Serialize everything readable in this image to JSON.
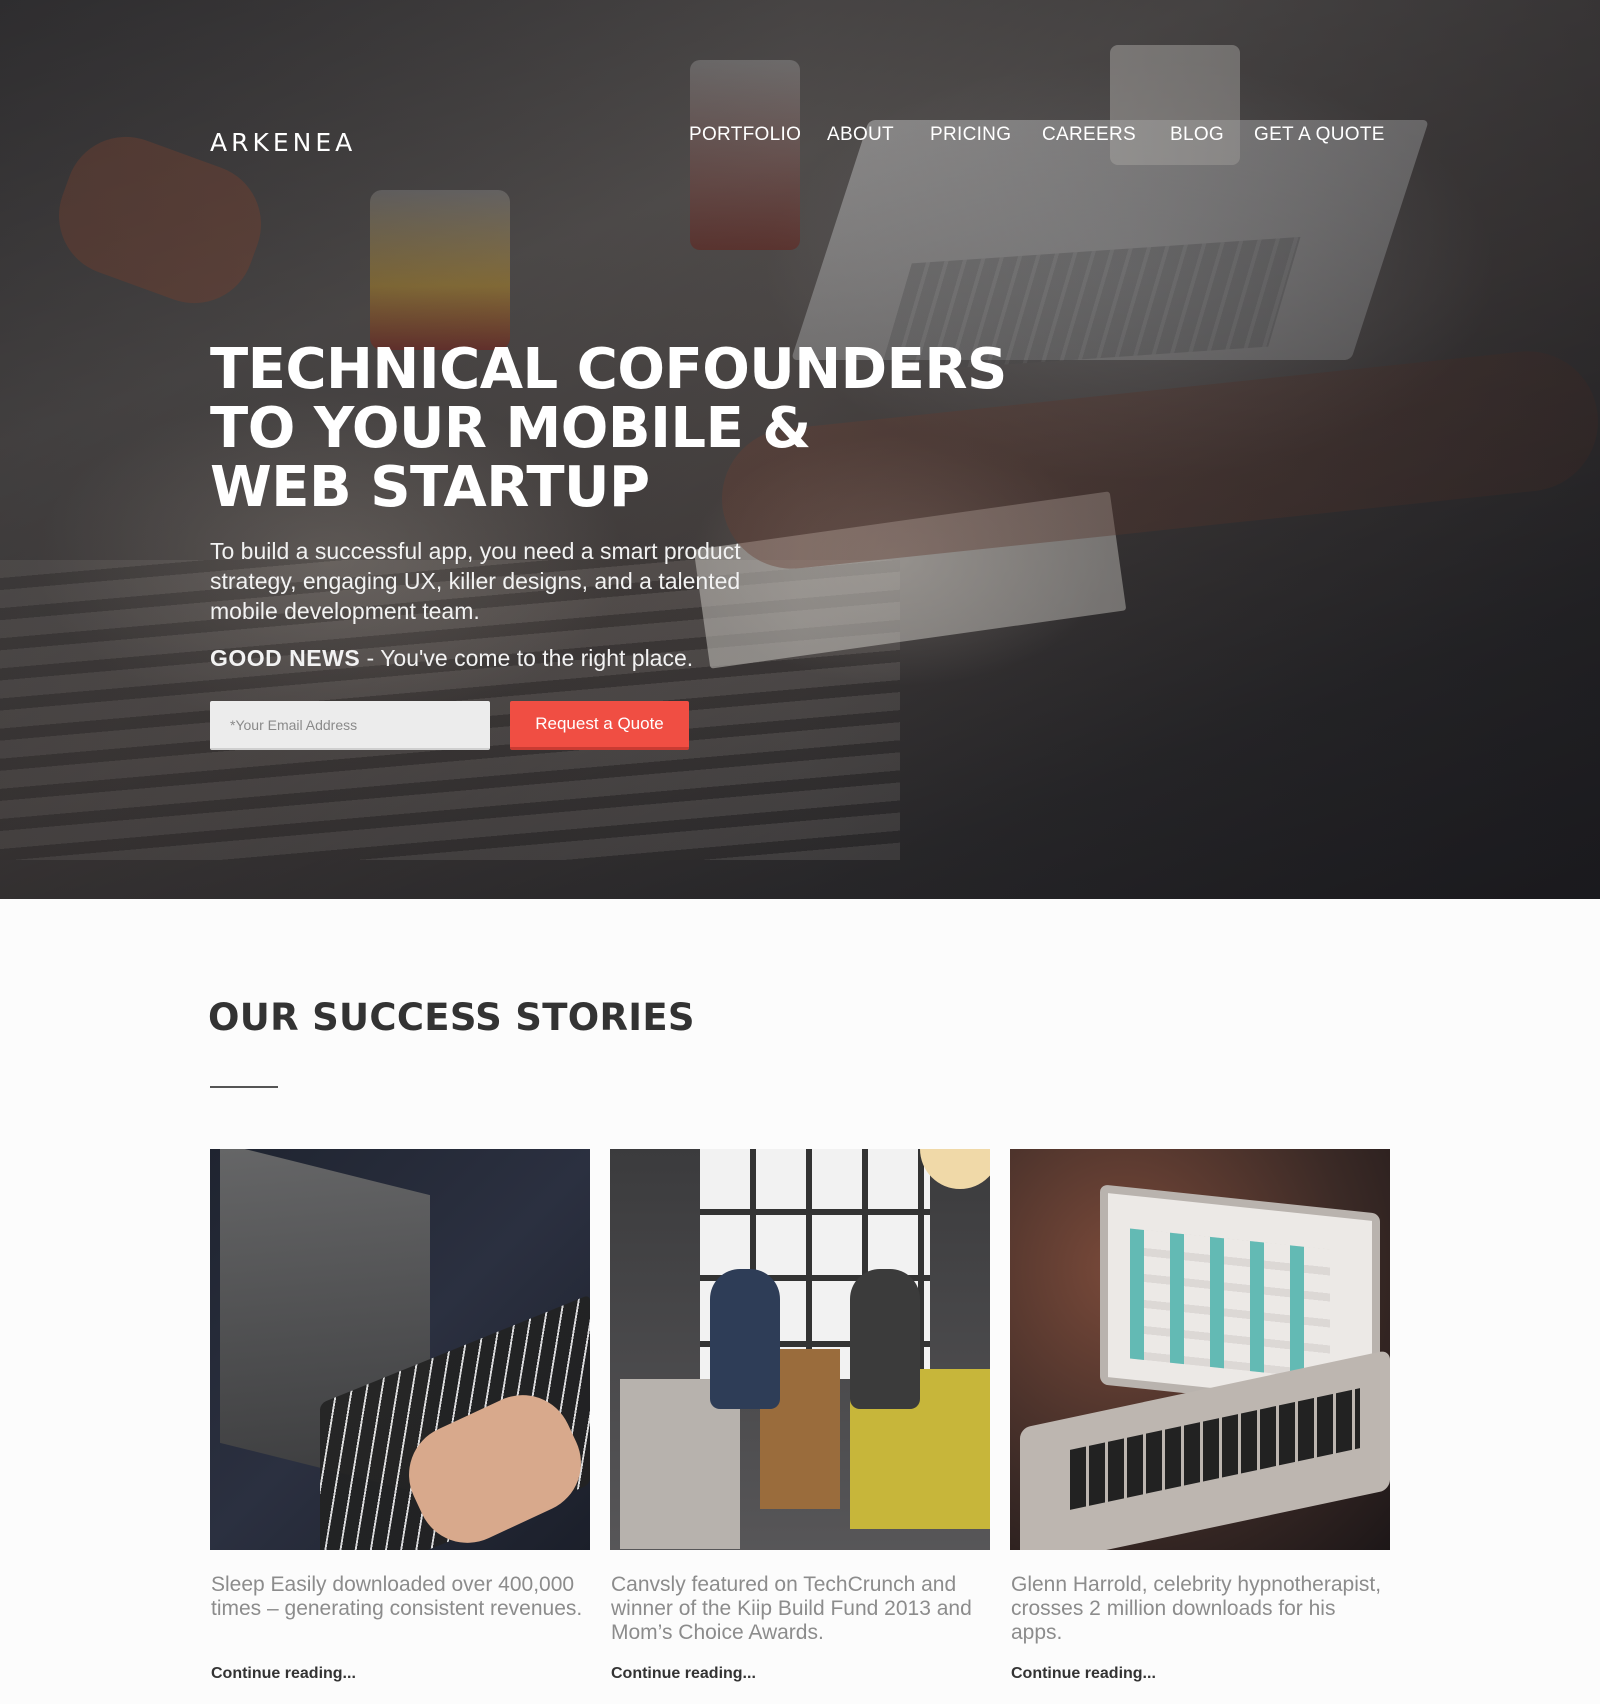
{
  "brand": {
    "logo_text": "ARKENEA",
    "accent_color": "#f04e43"
  },
  "nav": {
    "items": [
      {
        "label": "PORTFOLIO"
      },
      {
        "label": "ABOUT"
      },
      {
        "label": "PRICING"
      },
      {
        "label": "CAREERS"
      },
      {
        "label": "BLOG"
      },
      {
        "label": "GET A QUOTE"
      }
    ]
  },
  "hero": {
    "headline_lines": [
      "TECHNICAL COFOUNDERS",
      "TO YOUR MOBILE &",
      "WEB STARTUP"
    ],
    "subtext": "To build a successful app, you need a smart product strategy, engaging UX, killer designs, and a talented mobile development team.",
    "good_news_bold": "GOOD NEWS",
    "good_news_rest": " - You've come to the right place.",
    "email_placeholder": "*Your Email Address",
    "cta_label": "Request a Quote"
  },
  "stories": {
    "title": "OUR SUCCESS STORIES",
    "cards": [
      {
        "caption": "Sleep Easily downloaded over 400,000 times – generating consistent revenues.",
        "link": "Continue reading..."
      },
      {
        "caption": "Canvsly featured on TechCrunch and winner of the Kiip Build Fund 2013 and Mom’s Choice Awards.",
        "link": "Continue reading..."
      },
      {
        "caption": "Glenn Harrold, celebrity hypnotherapist, crosses 2 million downloads for his apps.",
        "link": "Continue reading..."
      }
    ]
  }
}
